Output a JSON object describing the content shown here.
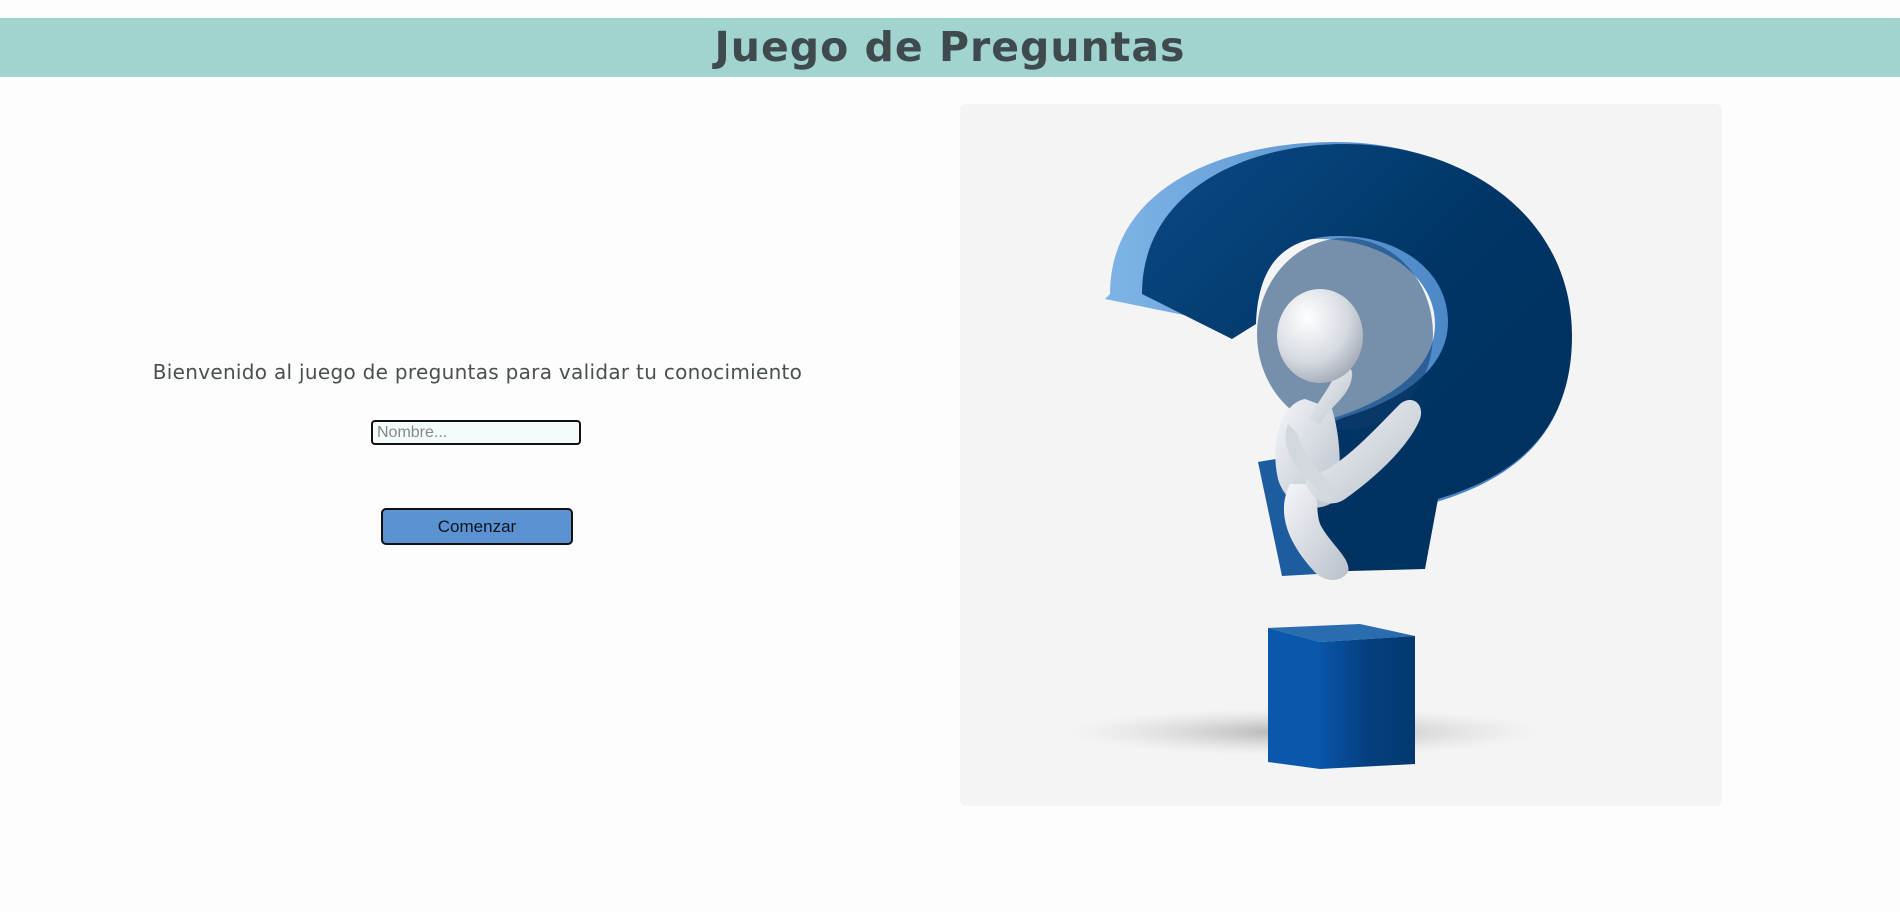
{
  "header": {
    "title": "Juego de Preguntas"
  },
  "welcome": {
    "message": "Bienvenido al juego de preguntas para validar tu conocimiento"
  },
  "form": {
    "name_placeholder": "Nombre...",
    "name_value": "",
    "start_label": "Comenzar"
  },
  "illustration": {
    "description": "question-mark-thinker-illustration"
  },
  "colors": {
    "header_bg": "#a1d4cf",
    "title_text": "#3f4a4e",
    "button_bg": "#5b92d1",
    "question_mark": "#003a6b",
    "card_bg": "#f4f4f4"
  }
}
